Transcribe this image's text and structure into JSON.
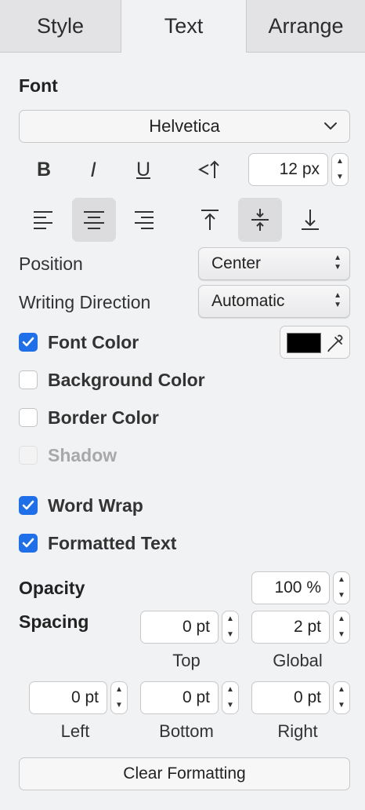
{
  "tabs": [
    {
      "label": "Style",
      "active": false
    },
    {
      "label": "Text",
      "active": true
    },
    {
      "label": "Arrange",
      "active": false
    }
  ],
  "font": {
    "heading": "Font",
    "family": "Helvetica",
    "size_value": "12 px",
    "format_buttons": [
      "B",
      "I",
      "U"
    ]
  },
  "alignment": {
    "horizontal_selected": "center",
    "vertical_selected": "middle"
  },
  "position": {
    "label": "Position",
    "value": "Center"
  },
  "writing_direction": {
    "label": "Writing Direction",
    "value": "Automatic"
  },
  "options": {
    "font_color": {
      "label": "Font Color",
      "checked": true,
      "color": "#000000"
    },
    "background_color": {
      "label": "Background Color",
      "checked": false
    },
    "border_color": {
      "label": "Border Color",
      "checked": false
    },
    "shadow": {
      "label": "Shadow",
      "checked": false,
      "disabled": true
    },
    "word_wrap": {
      "label": "Word Wrap",
      "checked": true
    },
    "formatted_text": {
      "label": "Formatted Text",
      "checked": true
    }
  },
  "opacity": {
    "label": "Opacity",
    "value": "100 %"
  },
  "spacing": {
    "label": "Spacing",
    "top": {
      "label": "Top",
      "value": "0 pt"
    },
    "global": {
      "label": "Global",
      "value": "2 pt"
    },
    "left": {
      "label": "Left",
      "value": "0 pt"
    },
    "bottom": {
      "label": "Bottom",
      "value": "0 pt"
    },
    "right": {
      "label": "Right",
      "value": "0 pt"
    }
  },
  "clear_formatting_label": "Clear Formatting",
  "colors": {
    "accent": "#1e6fe8",
    "panel_bg": "#f1f2f4",
    "tab_bg": "#e3e3e5"
  }
}
